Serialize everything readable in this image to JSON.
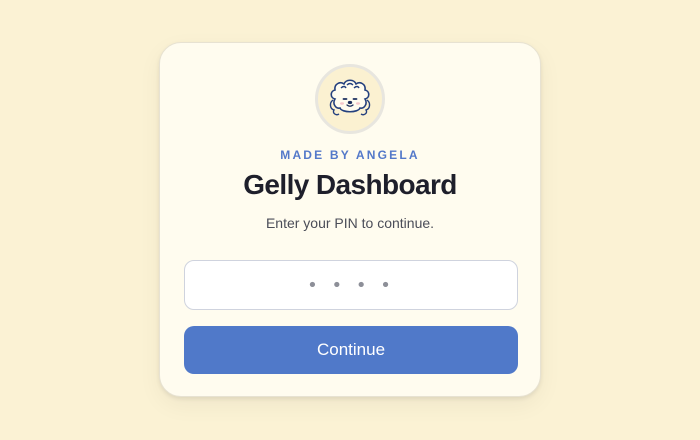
{
  "brand": {
    "eyebrow": "MADE BY ANGELA",
    "title": "Gelly Dashboard",
    "logo_icon": "poodle-face-icon"
  },
  "login": {
    "subtitle": "Enter your PIN to continue.",
    "pin_placeholder": "• • • •",
    "pin_value": "",
    "continue_label": "Continue"
  },
  "colors": {
    "page_background": "#fbf2d4",
    "card_background": "#fffcef",
    "accent": "#5079c9",
    "eyebrow": "#5479c9",
    "title": "#1e1f2b"
  }
}
